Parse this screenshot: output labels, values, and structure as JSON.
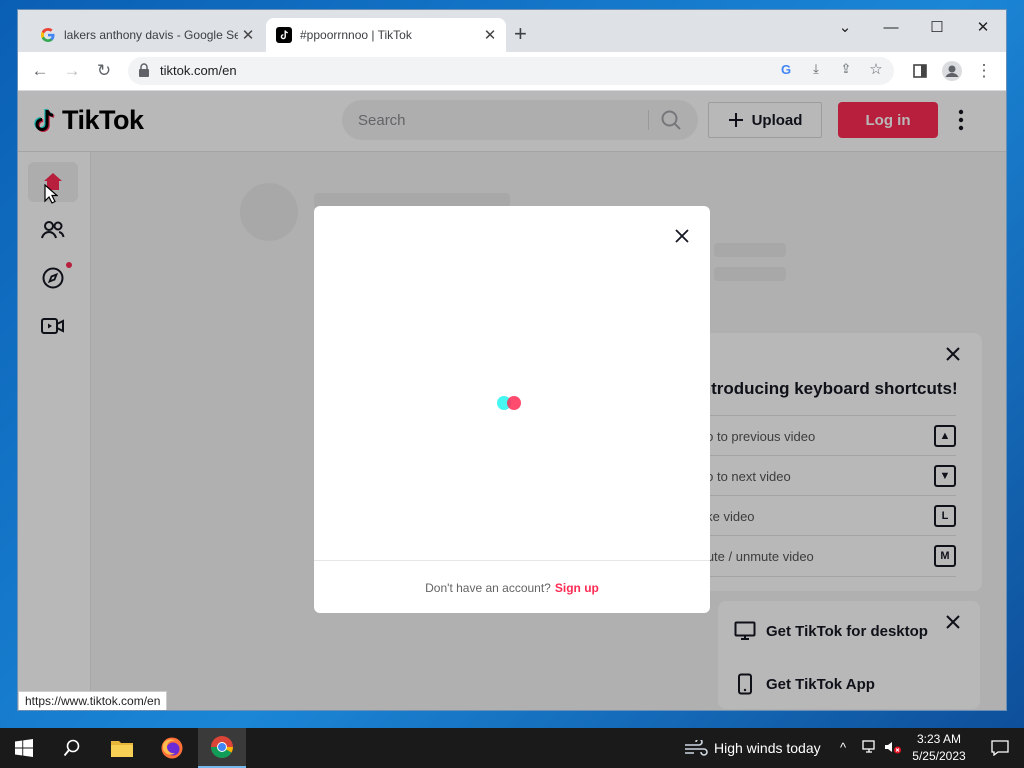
{
  "browser": {
    "tabs": [
      {
        "title": "lakers anthony davis - Google Se",
        "favicon": "google-g-icon"
      },
      {
        "title": "#ppoorrnnoo | TikTok",
        "favicon": "tiktok-icon"
      }
    ],
    "url": "tiktok.com/en",
    "status_url": "https://www.tiktok.com/en"
  },
  "tiktok": {
    "logo_text": "TikTok",
    "search_placeholder": "Search",
    "upload_label": "Upload",
    "login_label": "Log in",
    "nav": [
      "home-icon",
      "following-icon",
      "explore-icon",
      "live-icon"
    ],
    "keyboard_panel": {
      "title": "Introducing keyboard shortcuts!",
      "rows": [
        {
          "label": "Go to previous video",
          "key": "▲"
        },
        {
          "label": "Go to next video",
          "key": "▼"
        },
        {
          "label": "Like video",
          "key": "L"
        },
        {
          "label": "Mute / unmute video",
          "key": "M"
        }
      ]
    },
    "get_app": {
      "desktop_label": "Get TikTok for desktop",
      "app_label": "Get TikTok App"
    },
    "modal": {
      "footer_text": "Don't have an account?",
      "signup_label": "Sign up"
    }
  },
  "taskbar": {
    "weather": "High winds today",
    "time": "3:23 AM",
    "date": "5/25/2023"
  },
  "colors": {
    "tiktok_red": "#fe2c55",
    "tiktok_cyan": "#25f4ee"
  }
}
